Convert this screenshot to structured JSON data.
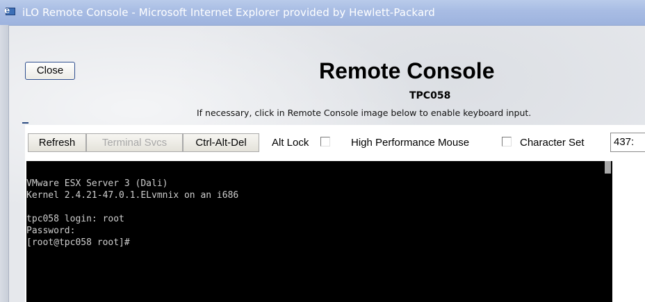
{
  "window": {
    "title": "iLO Remote Console - Microsoft Internet Explorer provided by Hewlett-Packard",
    "icon": "ie-icon"
  },
  "page": {
    "close_label": "Close",
    "heading": "Remote Console",
    "server_name": "TPC058",
    "hint": "If necessary, click in Remote Console image below to enable keyboard input."
  },
  "toolbar": {
    "refresh_label": "Refresh",
    "terminal_svcs_label": "Terminal Svcs",
    "ctrl_alt_del_label": "Ctrl-Alt-Del",
    "alt_lock_label": "Alt Lock",
    "alt_lock_checked": false,
    "high_perf_mouse_label": "High Performance Mouse",
    "high_perf_mouse_checked": false,
    "character_set_label": "Character Set",
    "character_set_value": "437: "
  },
  "console": {
    "lines": [
      "VMware ESX Server 3 (Dali)",
      "Kernel 2.4.21-47.0.1.ELvmnix on an i686",
      "",
      "tpc058 login: root",
      "Password:",
      "[root@tpc058 root]#"
    ]
  }
}
